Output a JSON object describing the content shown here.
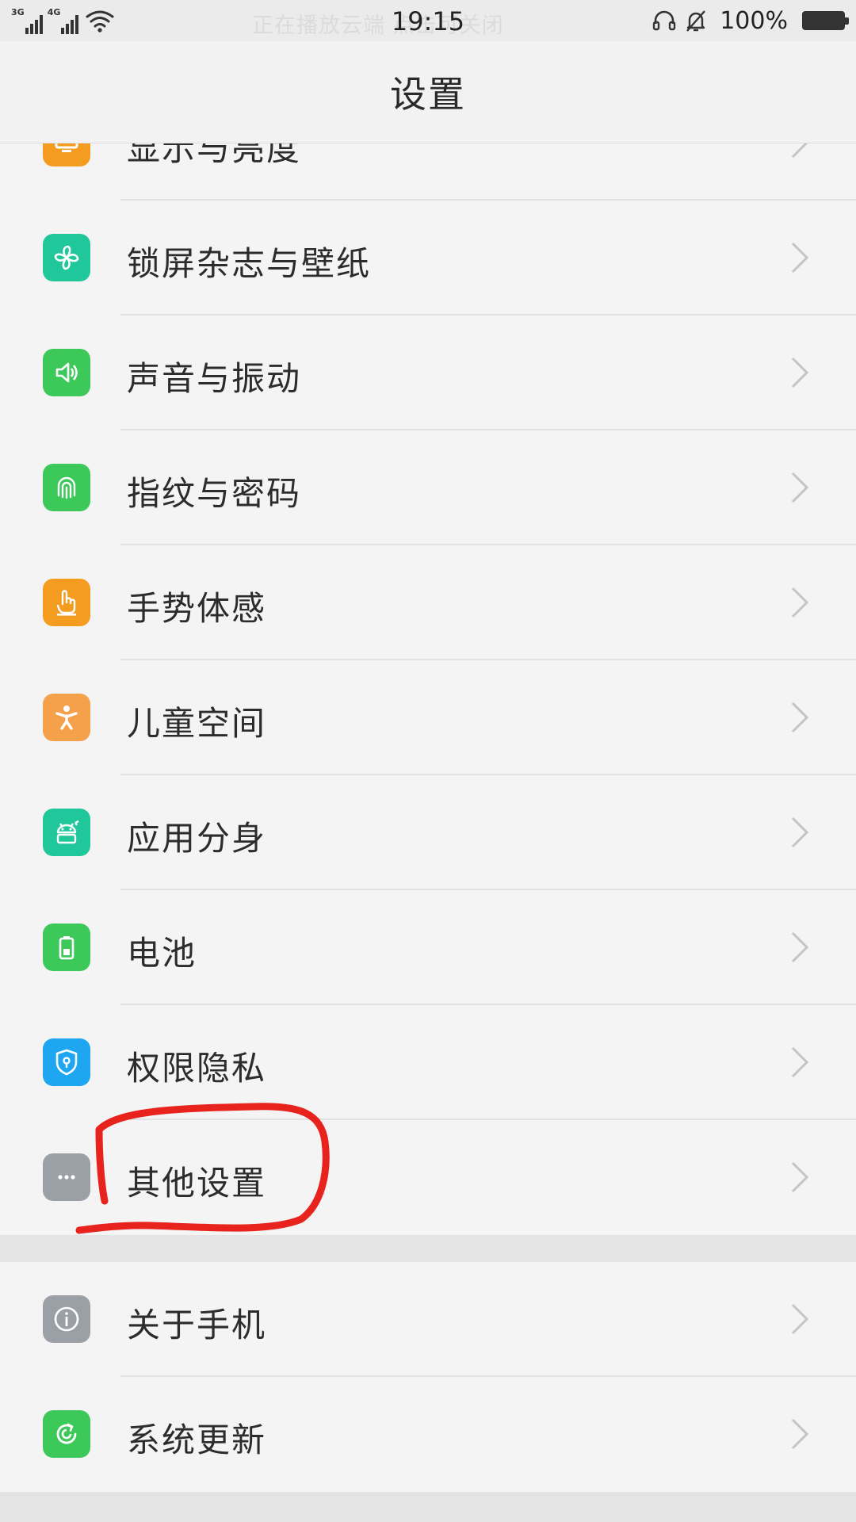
{
  "status_bar": {
    "network_1": "3G",
    "network_2": "4G",
    "notification_text": "正在播放云端 点击可关闭",
    "time": "19:15",
    "battery_percent": "100%",
    "battery_level": 1.0
  },
  "header": {
    "title": "设置"
  },
  "settings": {
    "items": [
      {
        "label": "显示与亮度",
        "icon": "display-icon",
        "color": "#f39c1f"
      },
      {
        "label": "锁屏杂志与壁纸",
        "icon": "pinwheel-icon",
        "color": "#1fc79a"
      },
      {
        "label": "声音与振动",
        "icon": "speaker-icon",
        "color": "#3dc95a"
      },
      {
        "label": "指纹与密码",
        "icon": "fingerprint-icon",
        "color": "#3dc95a"
      },
      {
        "label": "手势体感",
        "icon": "hand-pointer-icon",
        "color": "#f39c1f"
      },
      {
        "label": "儿童空间",
        "icon": "child-icon",
        "color": "#f5a04a"
      },
      {
        "label": "应用分身",
        "icon": "android-clone-icon",
        "color": "#1fc79a"
      },
      {
        "label": "电池",
        "icon": "battery-icon",
        "color": "#3dc95a"
      },
      {
        "label": "权限隐私",
        "icon": "shield-icon",
        "color": "#1ea6f0"
      },
      {
        "label": "其他设置",
        "icon": "more-dots-icon",
        "color": "#9aa0a6"
      }
    ],
    "system_items": [
      {
        "label": "关于手机",
        "icon": "info-icon",
        "color": "#9aa0a6"
      },
      {
        "label": "系统更新",
        "icon": "update-icon",
        "color": "#3dc95a"
      }
    ]
  },
  "annotation": {
    "color": "#e8231d"
  }
}
